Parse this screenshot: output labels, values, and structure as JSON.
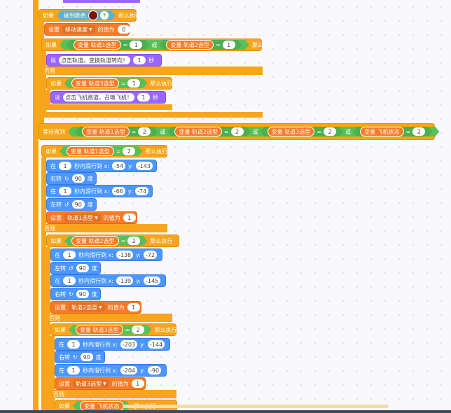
{
  "blocks": {
    "if_touch": {
      "kw_if": "如果",
      "sensor": "碰到颜色",
      "q": "?",
      "kw_then": "那么执行"
    },
    "set_speed": {
      "kw_set": "设置",
      "var": "移动速度",
      "mid": "的值为",
      "val": "0"
    },
    "if_or": {
      "kw_if": "如果",
      "var1": "变量 轨道1选型",
      "eq": "=",
      "v1": "1",
      "or": "或",
      "var2": "变量 轨道2选型",
      "v2": "1",
      "kw_then": "那么执行"
    },
    "say1": {
      "kw": "说",
      "text": "点击轨道，变换轨道转向！",
      "secs": "1",
      "unit": "秒"
    },
    "else1": "否则",
    "if_t3": {
      "kw_if": "如果",
      "var": "变量 轨道3选型",
      "eq": "=",
      "val": "1",
      "kw_then": "那么执行"
    },
    "say2": {
      "kw": "说",
      "text": "点击飞机跑道，召唤飞机！",
      "secs": "1",
      "unit": "秒"
    },
    "wait_until": {
      "kw": "等待直到",
      "var1": "变量 轨道1选型",
      "v1": "2",
      "or1": "或",
      "var2": "变量 轨道2选型",
      "v2": "2",
      "or2": "或",
      "var3": "变量 轨道3选型",
      "v3": "2",
      "or3": "或",
      "var4": "变量 飞机状态",
      "v4": "2",
      "eq": "="
    },
    "if_t1": {
      "kw_if": "如果",
      "var": "变量 轨道1选型",
      "eq": "=",
      "val": "2",
      "kw_then": "那么执行"
    },
    "glide1": {
      "kw": "在",
      "secs": "1",
      "txt": "秒内滑行到 x:",
      "x": "-54",
      "ylab": "y:",
      "y": "-143"
    },
    "turn_r1": {
      "kw": "右转",
      "sym": "↻",
      "deg": "90",
      "unit": "度"
    },
    "glide2": {
      "kw": "在",
      "secs": "1",
      "txt": "秒内滑行到 x:",
      "x": "-66",
      "ylab": "y:",
      "y": "-74"
    },
    "turn_l1": {
      "kw": "左转",
      "sym": "↺",
      "deg": "90",
      "unit": "度"
    },
    "set_t1": {
      "kw_set": "设置",
      "var": "轨道1选型",
      "mid": "的值为",
      "val": "1"
    },
    "else2": "否则",
    "if_t2": {
      "kw_if": "如果",
      "var": "变量 轨道2选型",
      "eq": "=",
      "val": "2",
      "kw_then": "那么执行"
    },
    "glide3": {
      "kw": "在",
      "secs": "1",
      "txt": "秒内滑行到 x:",
      "x": "-138",
      "ylab": "y:",
      "y": "-72"
    },
    "turn_l2": {
      "kw": "左转",
      "sym": "↺",
      "deg": "90",
      "unit": "度"
    },
    "glide4": {
      "kw": "在",
      "secs": "1",
      "txt": "秒内滑行到 x:",
      "x": "-139",
      "ylab": "y:",
      "y": "-145"
    },
    "turn_r2": {
      "kw": "右转",
      "sym": "↻",
      "deg": "90",
      "unit": "度"
    },
    "set_t2": {
      "kw_set": "设置",
      "var": "轨道2选型",
      "mid": "的值为",
      "val": "1"
    },
    "else3": "否则",
    "if_t3b": {
      "kw_if": "如果",
      "var": "变量 轨道3选型",
      "eq": "=",
      "val": "2",
      "kw_then": "那么执行"
    },
    "glide5": {
      "kw": "在",
      "secs": "1",
      "txt": "秒内滑行到 x:",
      "x": "-203",
      "ylab": "y:",
      "y": "-144"
    },
    "turn_r3": {
      "kw": "右转",
      "sym": "↻",
      "deg": "90",
      "unit": "度"
    },
    "glide6": {
      "kw": "在",
      "secs": "1",
      "txt": "秒内滑行到 x:",
      "x": "-204",
      "ylab": "y:",
      "y": "-90"
    },
    "set_t3": {
      "kw_set": "设置",
      "var": "轨道3选型",
      "mid": "的值为",
      "val": "1"
    },
    "else4": "否则",
    "if_plane": {
      "kw_if": "如果",
      "var": "变量 飞机状态",
      "kw_then": "那么执行"
    }
  },
  "colors": {
    "control": "#f7a51c",
    "data": "#f77b27",
    "looks": "#9a66ff",
    "motion": "#4c97ff",
    "operator": "#59c059"
  }
}
